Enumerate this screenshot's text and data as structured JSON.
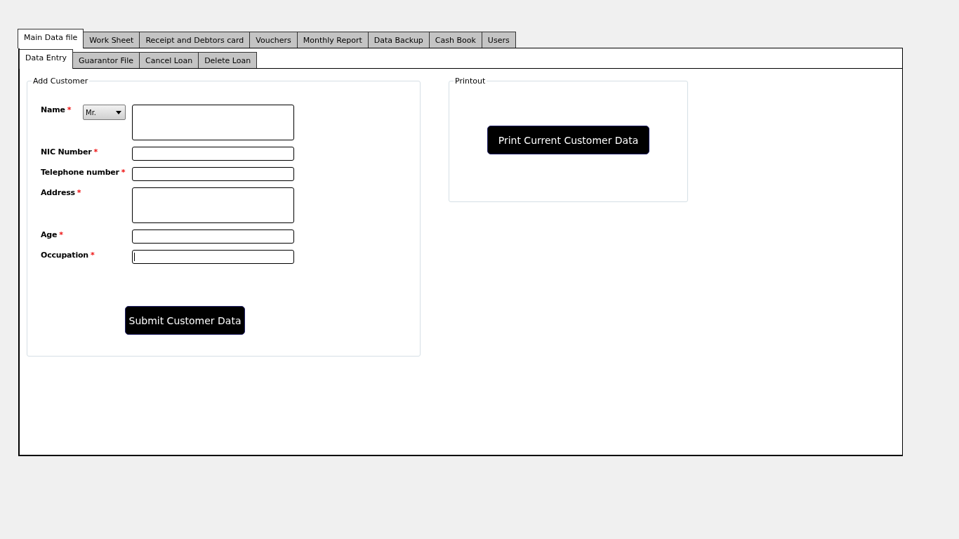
{
  "main_tabs": [
    {
      "label": "Main Data file",
      "selected": true
    },
    {
      "label": "Work Sheet",
      "selected": false
    },
    {
      "label": "Receipt and Debtors card",
      "selected": false
    },
    {
      "label": "Vouchers",
      "selected": false
    },
    {
      "label": "Monthly Report",
      "selected": false
    },
    {
      "label": "Data Backup",
      "selected": false
    },
    {
      "label": "Cash Book",
      "selected": false
    },
    {
      "label": "Users",
      "selected": false
    }
  ],
  "sub_tabs": [
    {
      "label": "Data Entry",
      "selected": true
    },
    {
      "label": "Guarantor File",
      "selected": false
    },
    {
      "label": "Cancel Loan",
      "selected": false
    },
    {
      "label": "Delete Loan",
      "selected": false
    }
  ],
  "add_customer": {
    "title": "Add Customer",
    "fields": [
      {
        "label": "Name",
        "required_mark": "*",
        "kind": "multiline",
        "focused": false,
        "title_select": {
          "value": "Mr."
        }
      },
      {
        "label": "NIC Number",
        "required_mark": "*",
        "kind": "line",
        "focused": false
      },
      {
        "label": "Telephone number",
        "required_mark": "*",
        "kind": "line",
        "focused": false
      },
      {
        "label": "Address",
        "required_mark": "*",
        "kind": "multiline",
        "focused": false
      },
      {
        "label": "Age",
        "required_mark": "*",
        "kind": "line",
        "focused": false
      },
      {
        "label": "Occupation",
        "required_mark": "*",
        "kind": "line",
        "focused": true
      }
    ],
    "submit_button": "Submit Customer Data"
  },
  "printout": {
    "title": "Printout",
    "print_button": "Print Current Customer Data"
  }
}
